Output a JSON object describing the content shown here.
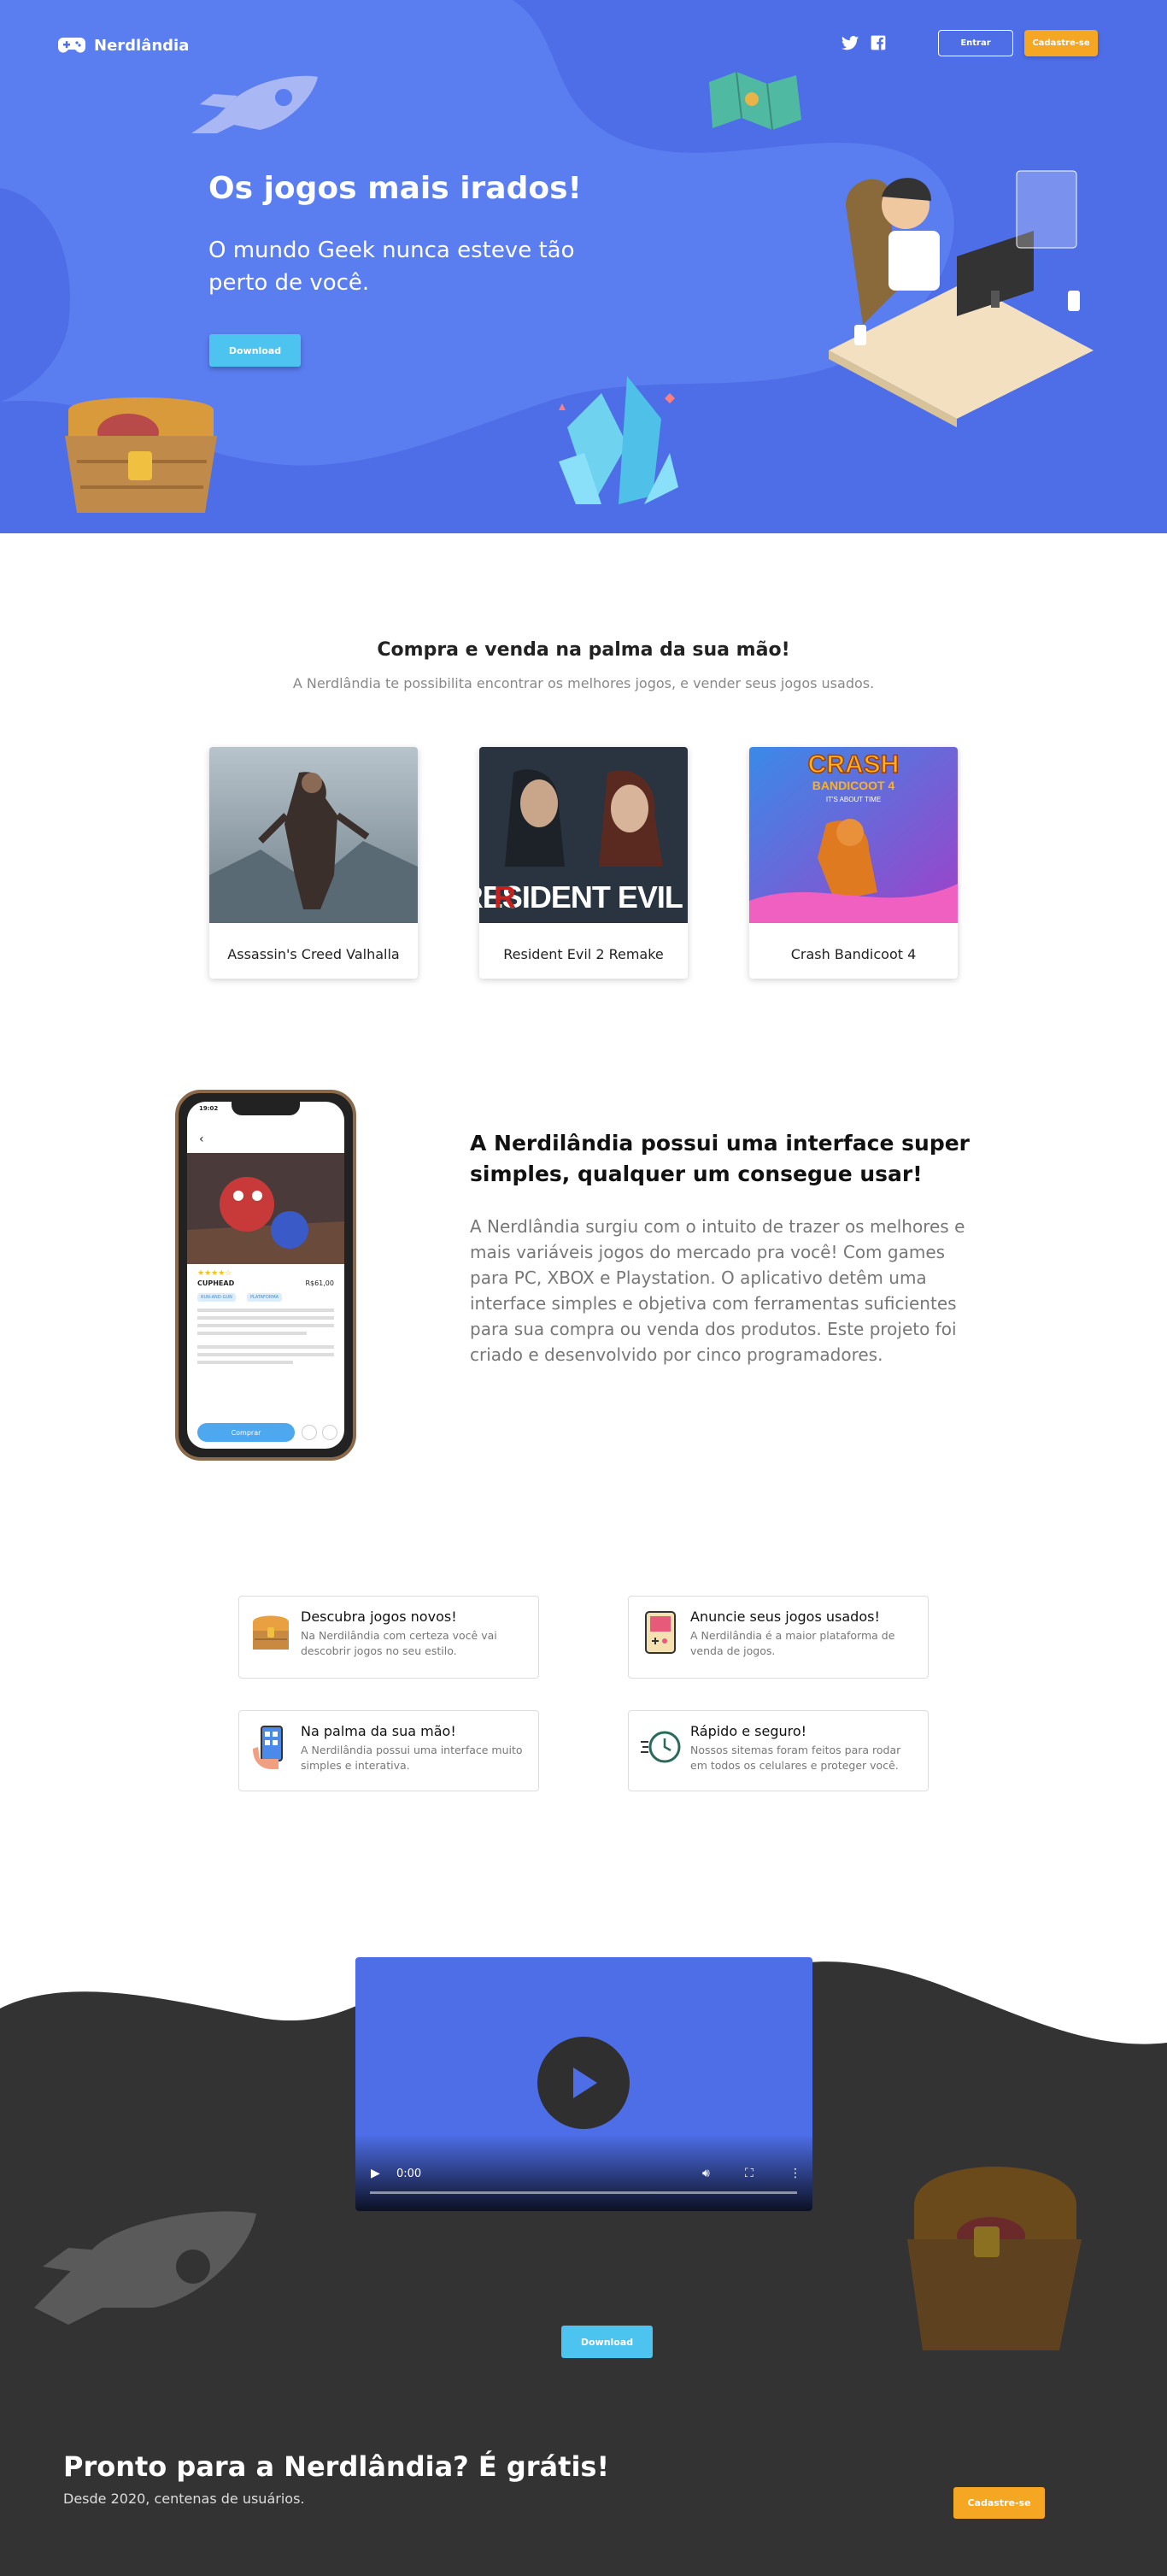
{
  "colors": {
    "hero_bg": "#4e6ee8",
    "accent_blue": "#4dc4f0",
    "accent_orange": "#f5a623",
    "dark_bg": "#333333"
  },
  "header": {
    "logo_text": "Nerdlândia",
    "logo_icon": "gamepad-icon",
    "social": [
      "twitter-icon",
      "facebook-icon"
    ],
    "login_label": "Entrar",
    "signup_label": "Cadastre-se"
  },
  "hero": {
    "title": "Os jogos mais irados!",
    "subtitle": "O mundo Geek nunca esteve tão perto de você.",
    "download_label": "Download"
  },
  "section_games": {
    "title": "Compra e venda na palma da sua mão!",
    "subtitle": "A Nerdlândia te possibilita encontrar os melhores jogos, e vender seus jogos usados.",
    "games": [
      {
        "name": "Assassin's Creed Valhalla"
      },
      {
        "name": "Resident Evil 2 Remake"
      },
      {
        "name": "Crash Bandicoot 4"
      }
    ]
  },
  "section_interface": {
    "title": "A Nerdilândia possui uma interface super simples, qualquer um consegue usar!",
    "text": "A Nerdlândia surgiu com o intuito de trazer os melhores e mais variáveis jogos do mercado pra você! Com games para PC, XBOX e Playstation. O aplicativo detêm uma interface simples e objetiva com ferramentas suficientes para sua compra ou venda dos produtos. Este projeto foi criado e desenvolvido por cinco programadores.",
    "phone": {
      "time": "19:02",
      "game_name": "CUPHEAD",
      "price": "R$61,00",
      "tags": [
        "RUN-AND-GUN",
        "PLATAFORMA"
      ],
      "buy_label": "Comprar"
    }
  },
  "features": [
    {
      "title": "Descubra jogos novos!",
      "text": "Na Nerdilândia com certeza você vai descobrir jogos no seu estilo.",
      "icon": "treasure-chest-icon"
    },
    {
      "title": "Anuncie seus jogos usados!",
      "text": "A Nerdilândia é a maior plataforma de venda de jogos.",
      "icon": "gameboy-icon"
    },
    {
      "title": "Na palma da sua mão!",
      "text": "A Nerdilândia possui uma interface muito simples e interativa.",
      "icon": "phone-in-hand-icon"
    },
    {
      "title": "Rápido e seguro!",
      "text": "Nossos sitemas foram feitos para rodar em todos os celulares e proteger você.",
      "icon": "fast-clock-icon"
    }
  ],
  "video": {
    "time": "0:00"
  },
  "cta": {
    "download_label": "Download",
    "title": "Pronto para a Nerdlândia? É grátis!",
    "subtitle": "Desde 2020, centenas de usuários.",
    "signup_label": "Cadastre-se"
  }
}
